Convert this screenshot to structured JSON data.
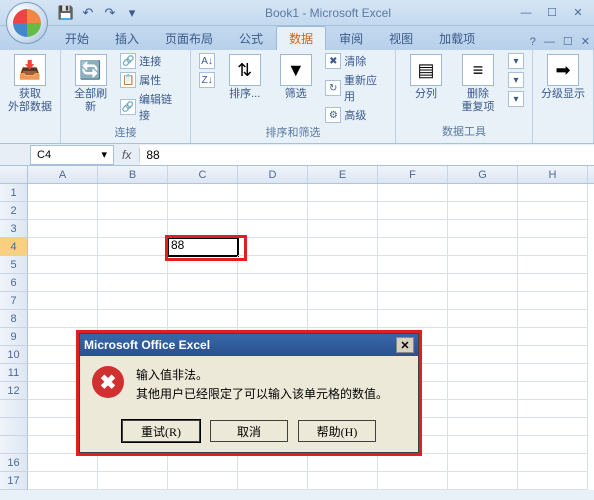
{
  "window": {
    "title": "Book1 - Microsoft Excel"
  },
  "qat": {
    "save": "💾",
    "undo": "↶",
    "redo": "↷",
    "dropdown": "▾"
  },
  "win_controls": {
    "min": "—",
    "max": "☐",
    "close": "✕"
  },
  "tabs": {
    "home": "开始",
    "insert": "插入",
    "layout": "页面布局",
    "formula": "公式",
    "data": "数据",
    "review": "审阅",
    "view": "视图",
    "addin": "加载项"
  },
  "ribbon": {
    "g1": {
      "get_data": "获取\n外部数据"
    },
    "g2": {
      "label": "连接",
      "refresh": "全部刷新",
      "conn": "连接",
      "prop": "属性",
      "edit_link": "编辑链接"
    },
    "g3": {
      "label": "排序和筛选",
      "sort": "排序...",
      "filter": "筛选",
      "clear": "清除",
      "reapply": "重新应用",
      "adv": "高级"
    },
    "g4": {
      "label": "数据工具",
      "t2c": "分列",
      "rmdup": "删除\n重复项",
      "more": "▾"
    },
    "g5": {
      "outline": "分级显示"
    }
  },
  "formula_bar": {
    "namebox": "C4",
    "fx": "fx",
    "value": "88"
  },
  "columns": [
    "A",
    "B",
    "C",
    "D",
    "E",
    "F",
    "G",
    "H"
  ],
  "rows": [
    "1",
    "2",
    "3",
    "4",
    "5",
    "6",
    "7",
    "8",
    "9",
    "10",
    "11",
    "12",
    "",
    "",
    "",
    "16",
    "17"
  ],
  "cell_value": "88",
  "dialog": {
    "title": "Microsoft Office Excel",
    "line1": "输入值非法。",
    "line2": "其他用户已经限定了可以输入该单元格的数值。",
    "retry": "重试(R)",
    "cancel": "取消",
    "help": "帮助(H)"
  }
}
